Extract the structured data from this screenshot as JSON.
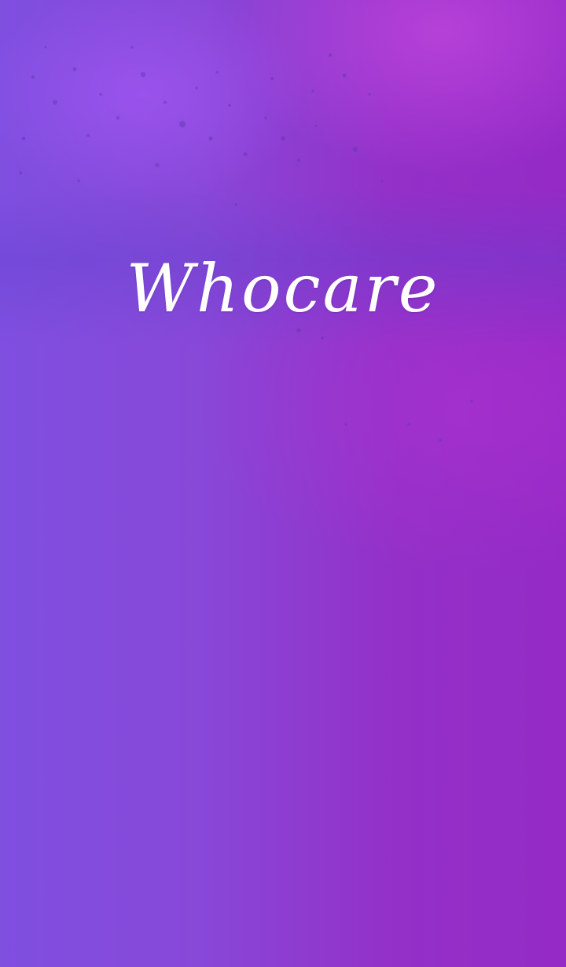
{
  "theme": {
    "title": "Whocare",
    "text_color": "#ffffff",
    "background_colors": [
      "#7f4fe0",
      "#8848d8",
      "#9330c8",
      "#952ac6"
    ]
  }
}
